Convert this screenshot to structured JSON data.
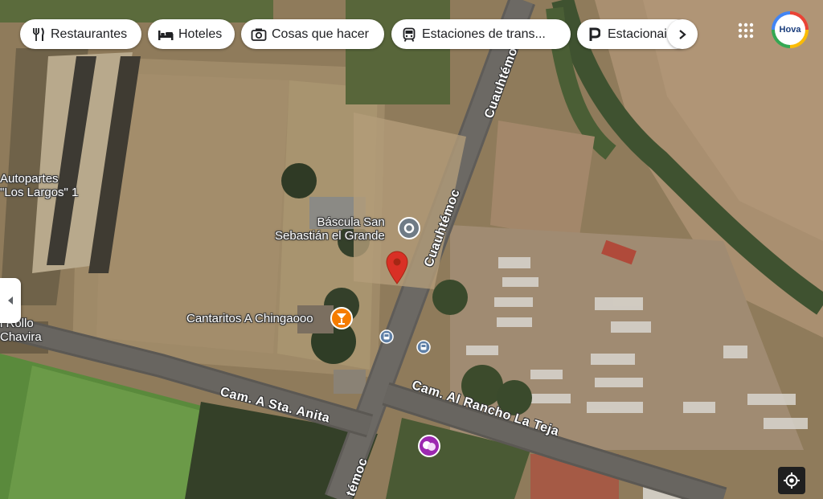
{
  "categories": [
    {
      "label": "Restaurantes",
      "icon": "fork-knife-icon"
    },
    {
      "label": "Hoteles",
      "icon": "bed-icon"
    },
    {
      "label": "Cosas que hacer",
      "icon": "camera-icon"
    },
    {
      "label": "Estaciones de trans...",
      "icon": "transit-icon"
    },
    {
      "label": "Estacionai",
      "icon": "parking-icon"
    }
  ],
  "avatar": {
    "text": "Hova"
  },
  "places": {
    "autopartes": "Autopartes\n\"Los Largos\" 1",
    "bascula": "Báscula San\nSebastián el Grande",
    "cantaritos": "Cantaritos A Chingaooo",
    "rollo": "l Rollo\nChavira"
  },
  "roads": {
    "cuauhtemoc_top": "Cuauhtémoc",
    "cuauhtemoc_mid": "Cuauhtémoc",
    "cuauhtemoc_bottom": "témoc",
    "sta_anita": "Cam. A Sta. Anita",
    "rancho_teja": "Cam. Al Rancho La Teja"
  },
  "colors": {
    "pin_red": "#d93025",
    "bar_orange": "#f57c00",
    "theater_purple": "#9c27b0",
    "place_gray": "#6f7b86"
  }
}
